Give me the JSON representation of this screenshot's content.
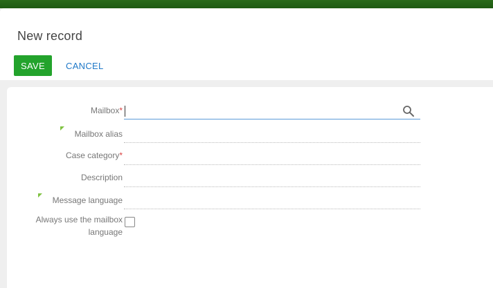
{
  "header": {
    "title": "New record",
    "save_label": "SAVE",
    "cancel_label": "CANCEL"
  },
  "form": {
    "mailbox_label": "Mailbox",
    "mailbox_value": "",
    "mailbox_alias_label": "Mailbox alias",
    "case_category_label": "Case category",
    "description_label": "Description",
    "message_language_label": "Message language",
    "always_use_label_line1": "Always use the mailbox",
    "always_use_label_line2": "language",
    "required_mark": "*",
    "always_use_checked": false
  },
  "colors": {
    "accent_green": "#23a32c",
    "link_blue": "#1e78c8",
    "required_red": "#d94040",
    "top_bar_green": "#2a6a1a"
  }
}
